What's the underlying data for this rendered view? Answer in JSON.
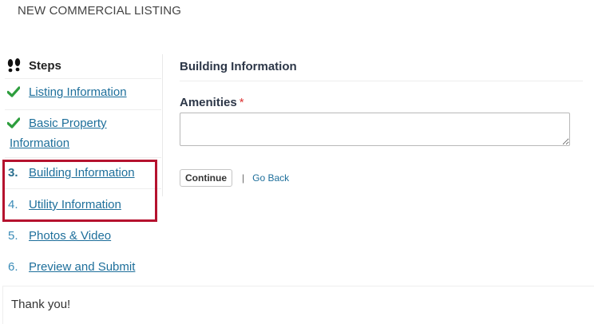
{
  "page": {
    "title": "NEW COMMERCIAL LISTING"
  },
  "sidebar": {
    "header": "Steps",
    "header_icon": "footsteps-icon",
    "steps": [
      {
        "marker": "",
        "label": "Listing Information",
        "status": "complete",
        "icon": "checkmark-icon"
      },
      {
        "marker": "",
        "label_line1": "Basic Property",
        "label_line2": "Information",
        "status": "complete",
        "icon": "checkmark-icon"
      },
      {
        "marker": "3.",
        "label": "Building Information",
        "status": "current"
      },
      {
        "marker": "4.",
        "label": "Utility Information",
        "status": "pending"
      },
      {
        "marker": "5.",
        "label": "Photos & Video",
        "status": "pending"
      },
      {
        "marker": "6.",
        "label": "Preview and Submit",
        "status": "pending"
      }
    ],
    "highlight_color": "#b5122e",
    "check_color": "#2e9e3e"
  },
  "main": {
    "section_title": "Building Information",
    "amenities": {
      "label": "Amenities",
      "required_mark": "*",
      "value": ""
    },
    "continue_label": "Continue",
    "separator": "|",
    "go_back_label": "Go Back"
  },
  "footer": {
    "text": "Thank you!"
  },
  "colors": {
    "link": "#1e6f9b",
    "required": "#dd3333"
  }
}
